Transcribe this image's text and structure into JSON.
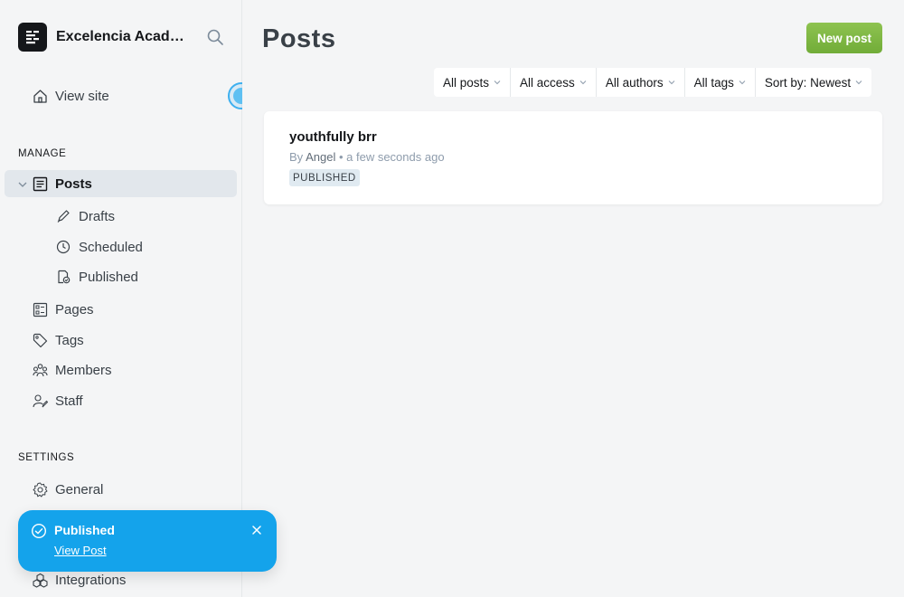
{
  "site": {
    "name": "Excelencia Academy"
  },
  "sidebar": {
    "view_site": "View site",
    "manage_label": "MANAGE",
    "settings_label": "SETTINGS",
    "items": {
      "posts": "Posts",
      "drafts": "Drafts",
      "scheduled": "Scheduled",
      "published": "Published",
      "pages": "Pages",
      "tags": "Tags",
      "members": "Members",
      "staff": "Staff",
      "general": "General",
      "integrations": "Integrations"
    }
  },
  "main": {
    "title": "Posts",
    "new_post_label": "New post",
    "filters": {
      "type": "All posts",
      "access": "All access",
      "authors": "All authors",
      "tags": "All tags",
      "sort": "Sort by: Newest"
    },
    "posts": [
      {
        "title": "youthfully brr",
        "by": "By",
        "author": "Angel",
        "separator": "•",
        "time": "a few seconds ago",
        "status": "PUBLISHED"
      }
    ]
  },
  "toast": {
    "title": "Published",
    "link": "View Post"
  },
  "colors": {
    "accent_green": "#7bb542",
    "toast_blue": "#14a3eb",
    "active_nav": "#e2e7ec"
  },
  "icons": [
    "logo-icon",
    "search-icon",
    "home-icon",
    "posts-icon",
    "pencil-icon",
    "clock-icon",
    "published-icon",
    "pages-icon",
    "tag-icon",
    "members-icon",
    "staff-icon",
    "gear-icon",
    "integrations-icon",
    "check-circle-icon",
    "close-icon",
    "chevron-down-icon"
  ]
}
